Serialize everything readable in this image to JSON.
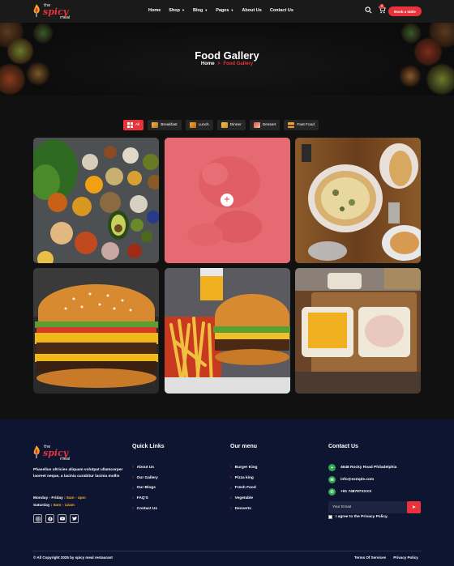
{
  "brand": {
    "top": "the",
    "main": "spicy",
    "bottom": "meal"
  },
  "nav": {
    "items": [
      {
        "label": "Home",
        "dropdown": false
      },
      {
        "label": "Shop",
        "dropdown": true
      },
      {
        "label": "Blog",
        "dropdown": true
      },
      {
        "label": "Pages",
        "dropdown": true
      },
      {
        "label": "About Us",
        "dropdown": false
      },
      {
        "label": "Contact Us",
        "dropdown": false
      }
    ],
    "cart_count": "0",
    "book_label": "Book a table"
  },
  "hero": {
    "title": "Food Gallery",
    "breadcrumb_home": "Home",
    "breadcrumb_sep": ">",
    "breadcrumb_current": "Food Gallery"
  },
  "filters": [
    {
      "label": "All",
      "icon": "grid-icon",
      "active": true
    },
    {
      "label": "Breakfast",
      "icon": "breakfast-icon",
      "active": false
    },
    {
      "label": "Lunch",
      "icon": "lunch-icon",
      "active": false
    },
    {
      "label": "Dinner",
      "icon": "dinner-icon",
      "active": false
    },
    {
      "label": "Dessert",
      "icon": "dessert-icon",
      "active": false
    },
    {
      "label": "Fast Food",
      "icon": "burger-icon",
      "active": false
    }
  ],
  "gallery": [
    {
      "name": "vegetables-spices"
    },
    {
      "name": "dessert-hover"
    },
    {
      "name": "pizza-table"
    },
    {
      "name": "cheeseburger"
    },
    {
      "name": "burger-fries"
    },
    {
      "name": "cheese-toast"
    }
  ],
  "footer": {
    "about": "Phasellus ultricies aliquam volutpat ullamcorper laoreet neque, a lacinia curabitur lacinia mollis",
    "hours": [
      {
        "label": "Monday - Friday :",
        "value": "8am - 4pm"
      },
      {
        "label": "Saturday :",
        "value": "8am - 12am"
      }
    ],
    "quick_links": {
      "title": "Quick Links",
      "items": [
        "About Us",
        "Our Gallery",
        "Our Blogs",
        "FAQ'S",
        "Contact Us"
      ]
    },
    "menu": {
      "title": "Our menu",
      "items": [
        "Burger King",
        "Pizza king",
        "Fresh Food",
        "Vegetable",
        "Desserts"
      ]
    },
    "contact": {
      "title": "Contact Us",
      "address": "4648 Rocky Road Philadelphia",
      "email": "info@exmple.com",
      "phone": "+91 748797XXXX",
      "email_placeholder": "Your Email",
      "agree": "I agree to the Privacy Policy."
    },
    "copyright": "© All Copyright 2025 by spicy meal restaurant",
    "legal": [
      "Terms Of Services",
      "Privacy Policy"
    ]
  },
  "colors": {
    "accent": "#e8333c",
    "footer_bg": "#0d1530",
    "page_bg": "#111111",
    "hours_highlight": "#f5a623"
  }
}
